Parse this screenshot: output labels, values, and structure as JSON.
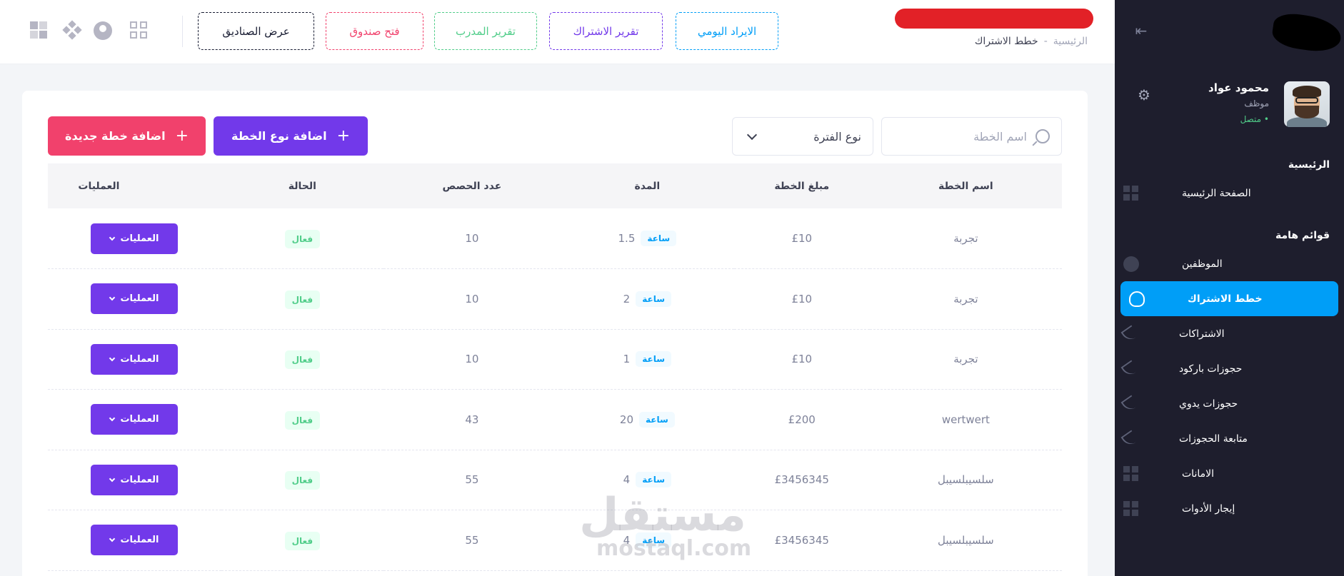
{
  "topbar": {
    "breadcrumb": {
      "home": "الرئيسية",
      "separator": "-",
      "current": "خطط الاشتراك"
    },
    "buttons": {
      "daily_income": "الايراد اليومي",
      "subscription_report": "تقرير الاشتراك",
      "coach_report": "تقرير المدرب",
      "open_box": "فتح صندوق",
      "show_boxes": "عرض الصناديق"
    },
    "icons": [
      "apps-grid-icon",
      "user-circle-icon",
      "diamond-dots-icon",
      "tiles-icon"
    ]
  },
  "sidebar": {
    "user": {
      "name": "محمود عواد",
      "role": "موظف",
      "status": "• متصل"
    },
    "sections": {
      "main": "الرئيسية",
      "lists": "قوائم هامة"
    },
    "items": [
      {
        "label": "الصفحة الرئيسية",
        "icon": "squares-icon"
      },
      {
        "label": "الموظفين",
        "icon": "person-icon"
      },
      {
        "label": "خطط الاشتراك",
        "icon": "fingerprint-icon",
        "active": true
      },
      {
        "label": "الاشتراكات",
        "icon": "leaf-icon"
      },
      {
        "label": "حجوزات باركود",
        "icon": "leaf-icon"
      },
      {
        "label": "حجوزات يدوي",
        "icon": "leaf-icon"
      },
      {
        "label": "متابعة الحجوزات",
        "icon": "leaf-icon"
      },
      {
        "label": "الامانات",
        "icon": "squares-icon"
      },
      {
        "label": "إيجار الأدوات",
        "icon": "squares-icon"
      }
    ]
  },
  "filters": {
    "search_placeholder": "اسم الخطة",
    "period_select": "نوع الفترة"
  },
  "actions": {
    "add_plan_type": "اضافة نوع الخطة",
    "add_new_plan": "اضافة خطة جديدة"
  },
  "table": {
    "columns": {
      "name": "اسم الخطة",
      "amount": "مبلغ الخطة",
      "duration": "المدة",
      "sessions": "عدد الحصص",
      "status": "الحالة",
      "operations": "العمليات"
    },
    "rows": [
      {
        "name": "تجربة",
        "amount": "£10",
        "duration": "1.5",
        "unit": "ساعة",
        "sessions": "10",
        "status": "فعال",
        "op": "العمليات"
      },
      {
        "name": "تجربة",
        "amount": "£10",
        "duration": "2",
        "unit": "ساعة",
        "sessions": "10",
        "status": "فعال",
        "op": "العمليات"
      },
      {
        "name": "تجربة",
        "amount": "£10",
        "duration": "1",
        "unit": "ساعة",
        "sessions": "10",
        "status": "فعال",
        "op": "العمليات"
      },
      {
        "name": "wertwert",
        "amount": "£200",
        "duration": "20",
        "unit": "ساعة",
        "sessions": "43",
        "status": "فعال",
        "op": "العمليات"
      },
      {
        "name": "سلسيبلسيبل",
        "amount": "£3456345",
        "duration": "4",
        "unit": "ساعة",
        "sessions": "55",
        "status": "فعال",
        "op": "العمليات"
      },
      {
        "name": "سلسيبلسيبل",
        "amount": "£3456345",
        "duration": "4",
        "unit": "ساعة",
        "sessions": "55",
        "status": "فعال",
        "op": "العمليات"
      }
    ]
  },
  "watermark": {
    "arabic": "مستقل",
    "latin": "mostaql.com"
  },
  "colors": {
    "primary": "#009ef7",
    "purple": "#7239ea",
    "success": "#50cd89",
    "danger": "#f1416c",
    "sidebar": "#1e1e2d"
  }
}
